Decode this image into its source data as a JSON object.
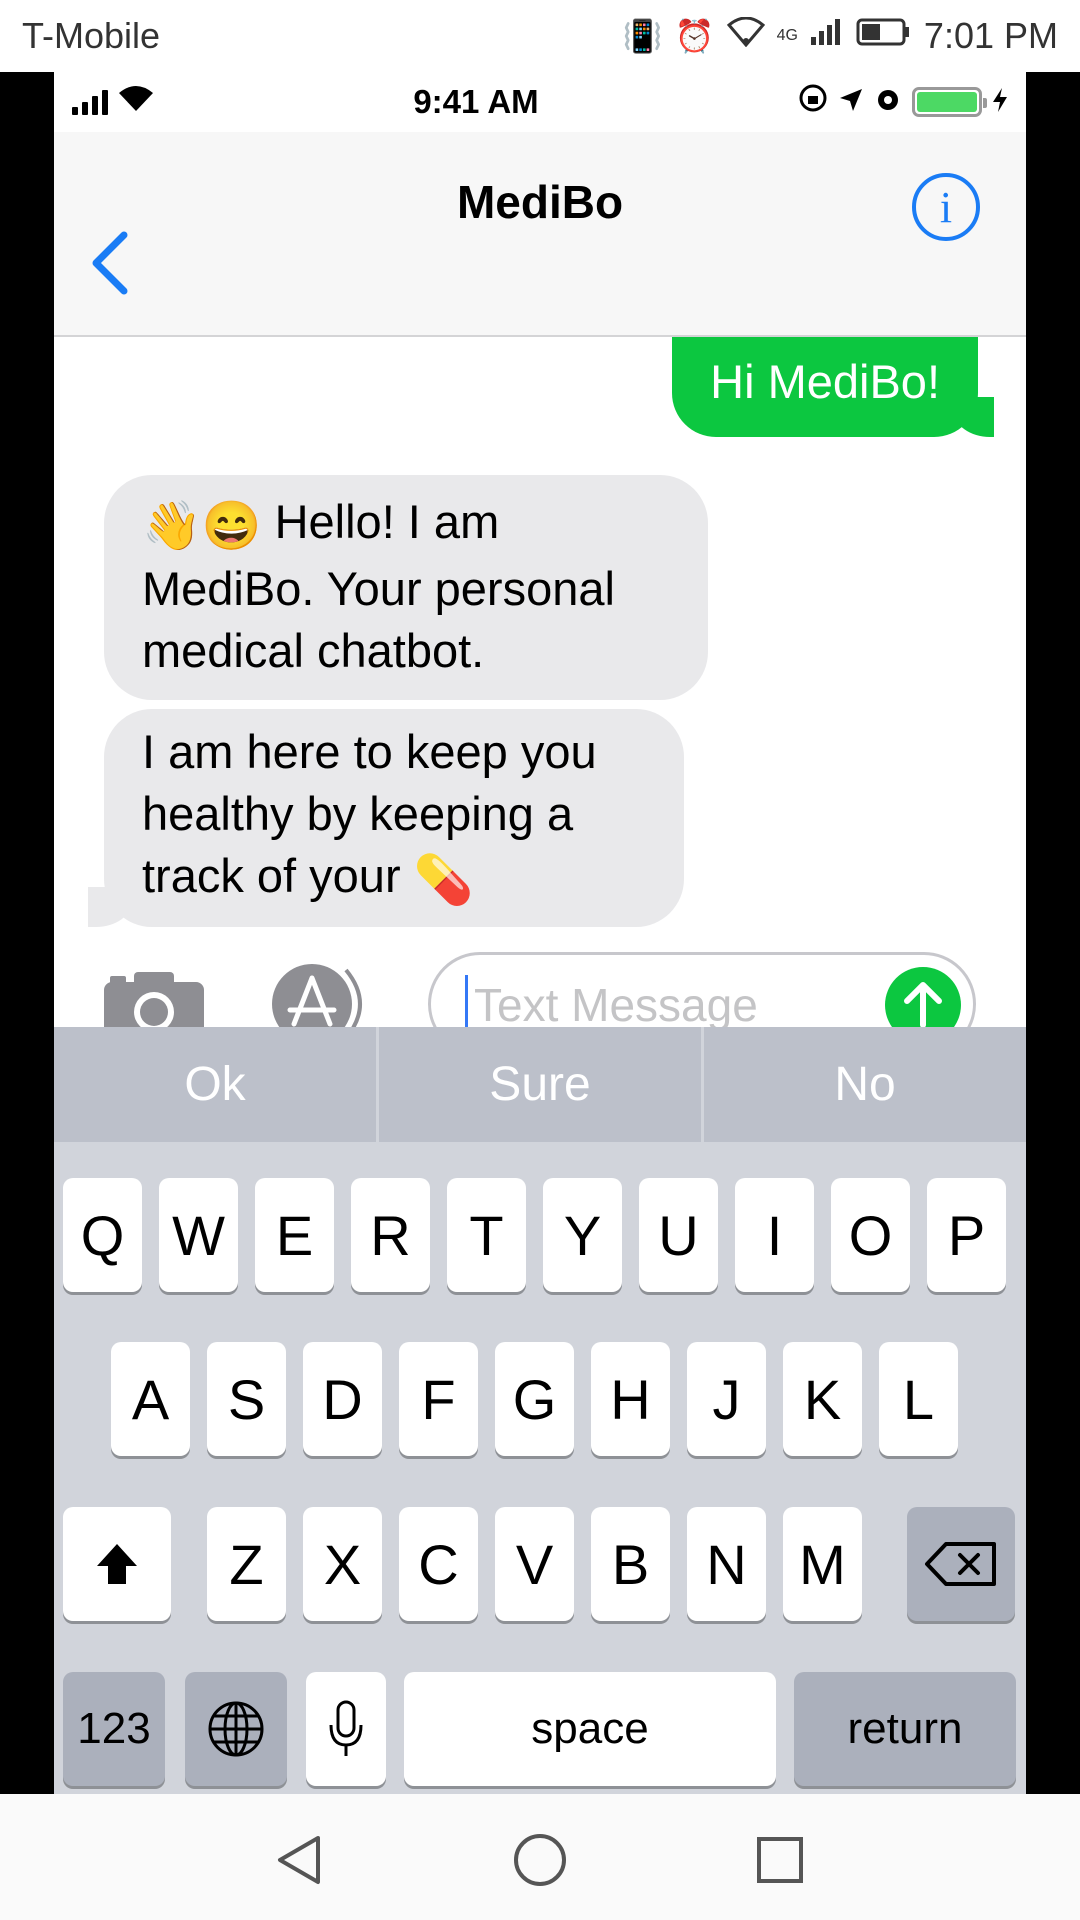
{
  "android_status": {
    "carrier": "T-Mobile",
    "network": "4G",
    "time": "7:01 PM"
  },
  "ios_status": {
    "time": "9:41 AM"
  },
  "nav": {
    "title": "MediBo",
    "info_symbol": "i"
  },
  "messages": [
    {
      "direction": "outgoing",
      "text": "Hi MediBo!"
    },
    {
      "direction": "incoming",
      "emoji": "👋😄",
      "text": " Hello! I am MediBo. Your personal medical chatbot."
    },
    {
      "direction": "incoming",
      "text": "I am here to keep you healthy by keeping a track of your ",
      "emoji": "💊"
    }
  ],
  "compose": {
    "placeholder": "Text Message"
  },
  "suggestions": [
    "Ok",
    "Sure",
    "No"
  ],
  "keyboard": {
    "row1": [
      "Q",
      "W",
      "E",
      "R",
      "T",
      "Y",
      "U",
      "I",
      "O",
      "P"
    ],
    "row2": [
      "A",
      "S",
      "D",
      "F",
      "G",
      "H",
      "J",
      "K",
      "L"
    ],
    "row3": [
      "Z",
      "X",
      "C",
      "V",
      "B",
      "N",
      "M"
    ],
    "numbers_label": "123",
    "space_label": "space",
    "return_label": "return"
  },
  "colors": {
    "ios_blue": "#1a7cf5",
    "imessage_green": "#0cc740",
    "incoming_bubble": "#e9e9eb",
    "keyboard_bg": "#d1d4db"
  }
}
